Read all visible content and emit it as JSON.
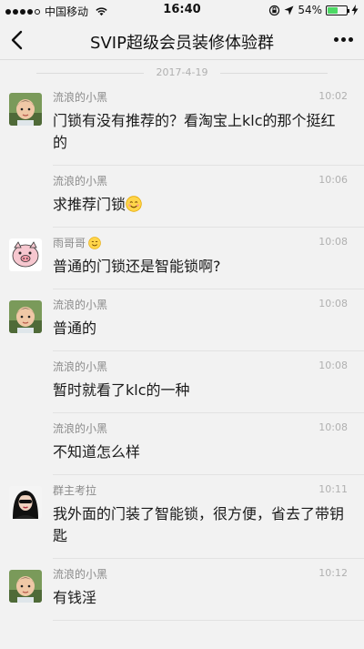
{
  "status_bar": {
    "carrier": "中国移动",
    "time": "16:40",
    "battery_text": "54%",
    "battery_level": 0.54,
    "signal_bars": 4
  },
  "nav": {
    "title": "SVIP超级会员装修体验群"
  },
  "date_divider": "2017-4-19",
  "messages": [
    {
      "name": "流浪的小黑",
      "time": "10:02",
      "text": "门锁有没有推荐的？看淘宝上klc的那个挺红的",
      "avatar": "boy-avatar"
    },
    {
      "name": "流浪的小黑",
      "time": "10:06",
      "text": "求推荐门锁",
      "emoji": "smile-emoji-icon"
    },
    {
      "name": "雨哥哥",
      "name_emoji": "smile-emoji-icon",
      "time": "10:08",
      "text": "普通的门锁还是智能锁啊?",
      "avatar": "pig-avatar"
    },
    {
      "name": "流浪的小黑",
      "time": "10:08",
      "text": "普通的",
      "avatar": "boy-avatar"
    },
    {
      "name": "流浪的小黑",
      "time": "10:08",
      "text": "暂时就看了klc的一种"
    },
    {
      "name": "流浪的小黑",
      "time": "10:08",
      "text": "不知道怎么样"
    },
    {
      "name": "群主考拉",
      "time": "10:11",
      "text": "我外面的门装了智能锁，很方便，省去了带钥匙",
      "avatar": "woman-avatar"
    },
    {
      "name": "流浪的小黑",
      "time": "10:12",
      "text": "有钱淫",
      "avatar": "boy-avatar"
    }
  ],
  "colors": {
    "background": "#f2f2f2",
    "battery_green": "#4cd964",
    "name_gray": "#8a8a8a",
    "time_gray": "#b0b0b0"
  }
}
